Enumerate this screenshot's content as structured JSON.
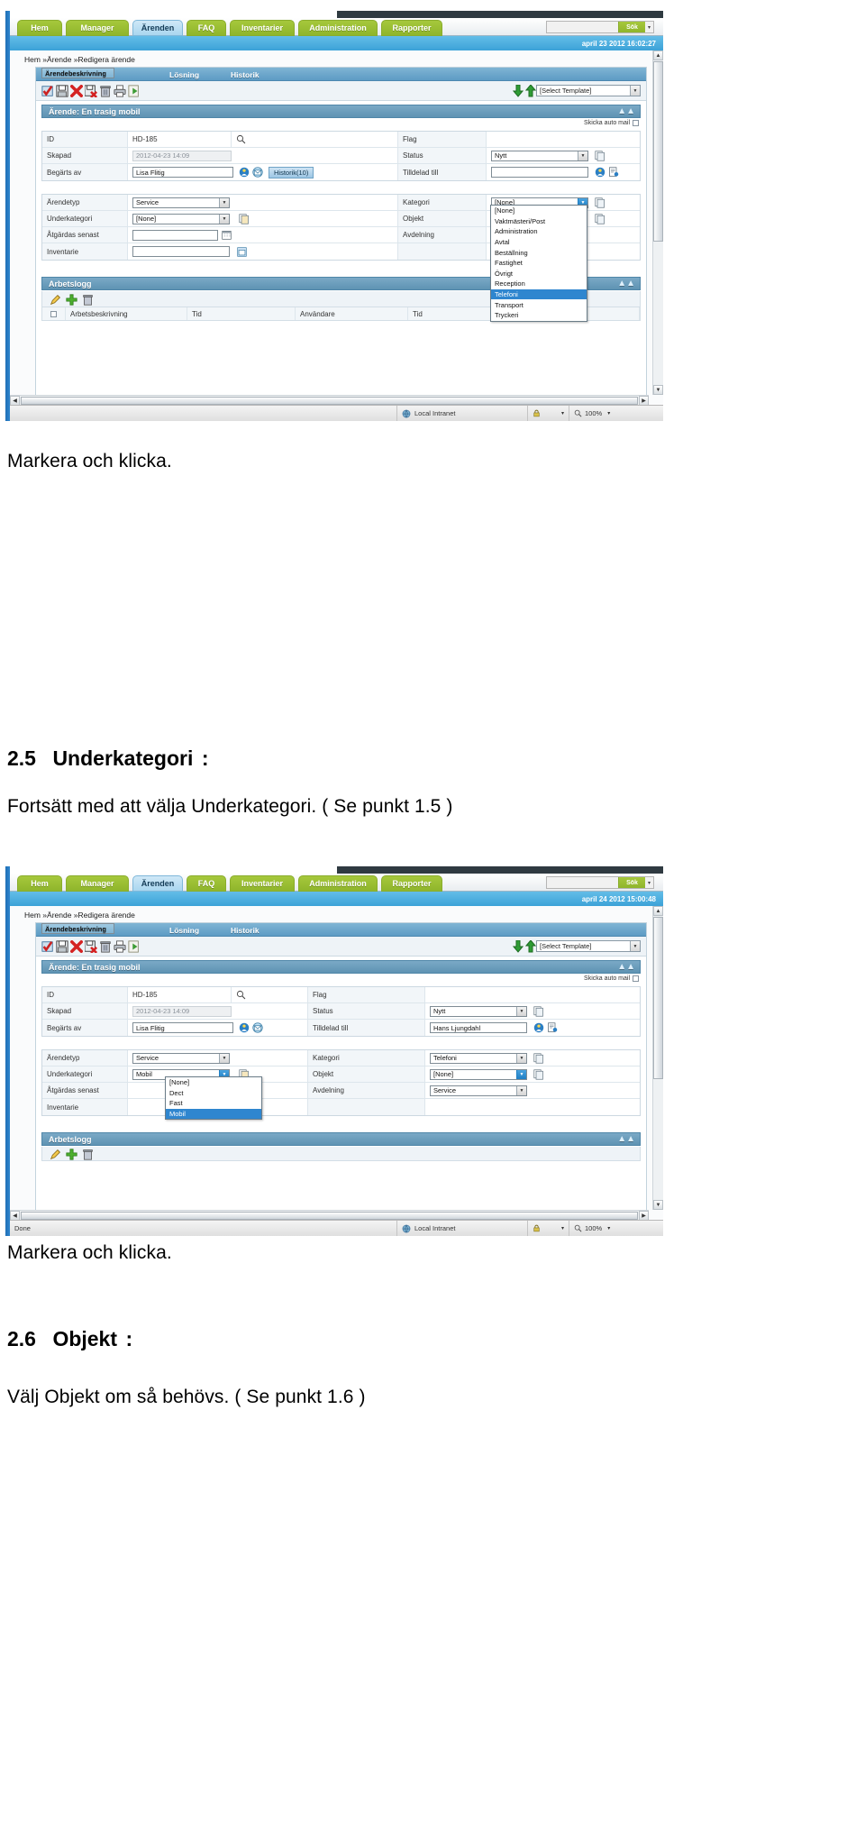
{
  "document": {
    "caption_1": "Markera och klicka.",
    "section_25_num": "2.5",
    "section_25_title": "Underkategori",
    "section_25_colon": ":",
    "section_25_body": "Fortsätt med att välja Underkategori. ( Se punkt 1.5 )",
    "caption_2": "Markera och klicka.",
    "section_26_num": "2.6",
    "section_26_title": "Objekt",
    "section_26_colon": ":",
    "section_26_body": "Välj Objekt om så behövs. ( Se punkt 1.6 )"
  },
  "shot1": {
    "nav_tabs": [
      {
        "label": "Hem",
        "active": false
      },
      {
        "label": "Manager",
        "active": false
      },
      {
        "label": "Ärenden",
        "active": true
      },
      {
        "label": "FAQ",
        "active": false
      },
      {
        "label": "Inventarier",
        "active": false
      },
      {
        "label": "Administration",
        "active": false
      },
      {
        "label": "Rapporter",
        "active": false
      }
    ],
    "search": {
      "value": "",
      "button_label": "Sök"
    },
    "datetime": "april 23 2012 16:02:27",
    "breadcrumb": "Hem »Ärende »Redigera ärende",
    "panel_tabs": [
      {
        "label": "Ärendebeskrivning",
        "selected": true
      },
      {
        "label": "Lösning",
        "selected": false
      },
      {
        "label": "Historik",
        "selected": false
      }
    ],
    "toolbar_icons": [
      "save-check-icon",
      "save-disk-icon",
      "delete-x-icon",
      "save-as-icon",
      "trash-icon",
      "print-icon",
      "export-icon"
    ],
    "template_select": "[Select Template]",
    "case_title": "Ärende: En trasig mobil",
    "auto_mail_label": "Skicka auto mail",
    "fields": {
      "id_label": "ID",
      "id_value": "HD-185",
      "flag_label": "Flag",
      "skapad_label": "Skapad",
      "skapad_value": "2012-04-23 14:09",
      "status_label": "Status",
      "status_value": "Nytt",
      "begarts_label": "Begärts av",
      "begarts_value": "Lisa Flitig",
      "historik_button": "Historik(10)",
      "tilldelad_label": "Tilldelad till",
      "tilldelad_value": "",
      "arendetyp_label": "Ärendetyp",
      "arendetyp_value": "Service",
      "kategori_label": "Kategori",
      "kategori_value": "[None]",
      "underkategori_label": "Underkategori",
      "underkategori_value": "[None]",
      "objekt_label": "Objekt",
      "objekt_value": "",
      "atgardas_label": "Åtgärdas senast",
      "atgardas_value": "",
      "avdelning_label": "Avdelning",
      "avdelning_value": "",
      "inventarie_label": "Inventarie",
      "inventarie_value": ""
    },
    "kategori_dropdown": {
      "open": true,
      "options": [
        "[None]",
        "Vaktmästeri/Post",
        "Administration",
        "Avtal",
        "Beställning",
        "Fastighet",
        "Övrigt",
        "Reception",
        "Telefoni",
        "Transport",
        "Tryckeri"
      ],
      "highlighted": "Telefoni"
    },
    "worklog": {
      "title": "Arbetslogg",
      "toolbar_icons": [
        "edit-pencil-icon",
        "add-plus-icon",
        "trash-icon"
      ],
      "columns": [
        "Arbetsbeskrivning",
        "Tid",
        "Användare",
        "Tid",
        "Användare"
      ]
    },
    "statusbar": {
      "zone": "Local Intranet",
      "zoom": "100%",
      "state": ""
    }
  },
  "shot2": {
    "nav_tabs": [
      {
        "label": "Hem",
        "active": false
      },
      {
        "label": "Manager",
        "active": false
      },
      {
        "label": "Ärenden",
        "active": true
      },
      {
        "label": "FAQ",
        "active": false
      },
      {
        "label": "Inventarier",
        "active": false
      },
      {
        "label": "Administration",
        "active": false
      },
      {
        "label": "Rapporter",
        "active": false
      }
    ],
    "search": {
      "value": "",
      "button_label": "Sök"
    },
    "datetime": "april 24 2012 15:00:48",
    "breadcrumb": "Hem »Ärende »Redigera ärende",
    "panel_tabs": [
      {
        "label": "Ärendebeskrivning",
        "selected": true
      },
      {
        "label": "Lösning",
        "selected": false
      },
      {
        "label": "Historik",
        "selected": false
      }
    ],
    "toolbar_icons": [
      "save-check-icon",
      "save-disk-icon",
      "delete-x-icon",
      "save-as-icon",
      "trash-icon",
      "print-icon",
      "export-icon"
    ],
    "template_select": "[Select Template]",
    "case_title": "Ärende: En trasig mobil",
    "auto_mail_label": "Skicka auto mail",
    "fields": {
      "id_label": "ID",
      "id_value": "HD-185",
      "flag_label": "Flag",
      "skapad_label": "Skapad",
      "skapad_value": "2012-04-23 14:09",
      "status_label": "Status",
      "status_value": "Nytt",
      "begarts_label": "Begärts av",
      "begarts_value": "Lisa Flitig",
      "tilldelad_label": "Tilldelad till",
      "tilldelad_value": "Hans Ljungdahl",
      "arendetyp_label": "Ärendetyp",
      "arendetyp_value": "Service",
      "kategori_label": "Kategori",
      "kategori_value": "Telefoni",
      "underkategori_label": "Underkategori",
      "underkategori_value": "Mobil",
      "objekt_label": "Objekt",
      "objekt_value": "[None]",
      "atgardas_label": "Åtgärdas senast",
      "atgardas_value": "",
      "avdelning_label": "Avdelning",
      "avdelning_value": "Service",
      "inventarie_label": "Inventarie",
      "inventarie_value": ""
    },
    "underkategori_dropdown": {
      "open": true,
      "options": [
        "[None]",
        "Dect",
        "Fast",
        "Mobil"
      ],
      "highlighted": "Mobil"
    },
    "worklog": {
      "title": "Arbetslogg",
      "toolbar_icons": [
        "edit-pencil-icon",
        "add-plus-icon",
        "trash-icon"
      ]
    },
    "statusbar": {
      "zone": "Local Intranet",
      "zoom": "100%",
      "state": "Done"
    }
  },
  "colors": {
    "tab_green": "#a6c83c",
    "tab_active_blue": "#a9d6ef",
    "header_blue": "#3ca2d8",
    "panel_blue": "#5f93b3",
    "highlight_blue": "#2f86cf"
  }
}
